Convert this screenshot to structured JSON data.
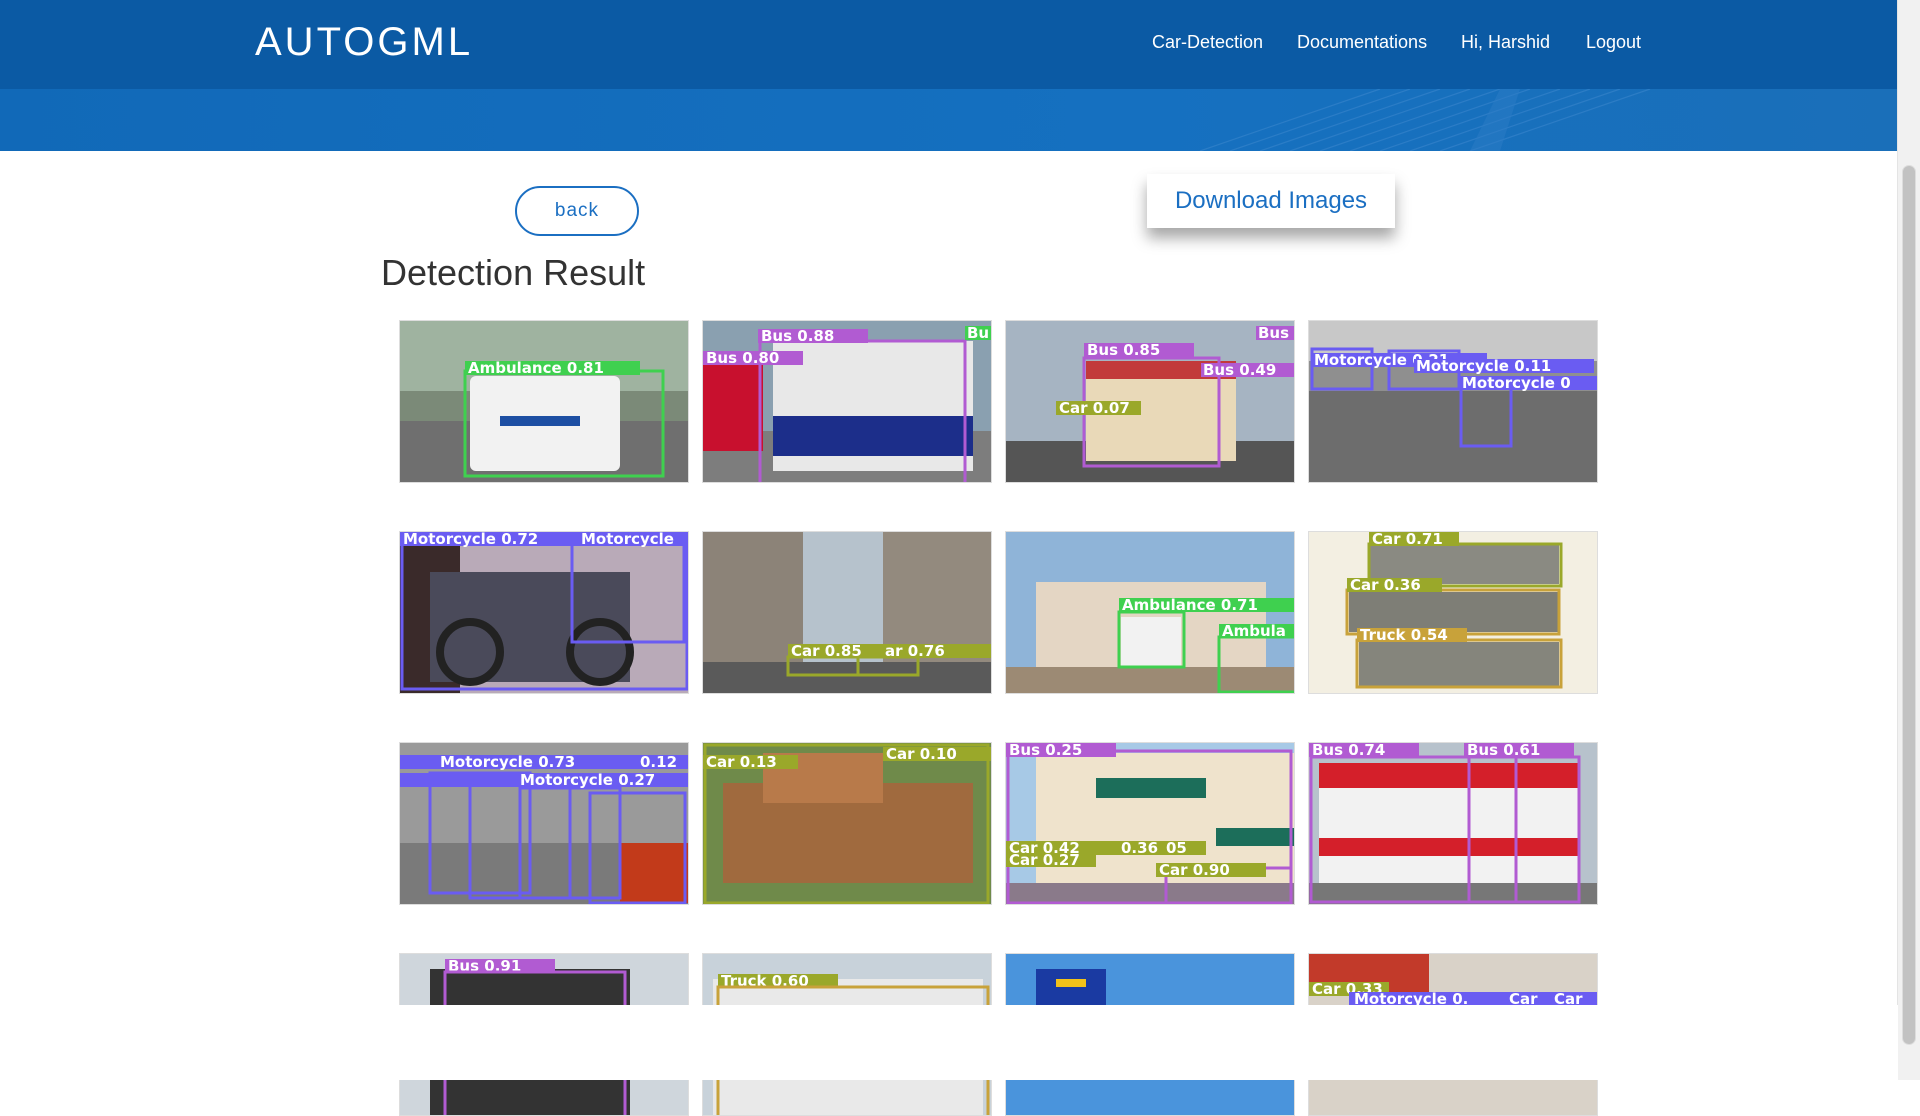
{
  "header": {
    "brand": "AUTOGML",
    "nav": [
      "Car-Detection",
      "Documentations",
      "Hi, Harshid",
      "Logout"
    ]
  },
  "actions": {
    "back_label": "back",
    "download_label": "Download Images"
  },
  "page_title": "Detection Result",
  "colors": {
    "header": "#0b5aa4",
    "accent": "#1b6fc2"
  },
  "results": [
    {
      "labels": [
        "Ambulance 0.81"
      ]
    },
    {
      "labels": [
        "Bus 0.88",
        "Bus 0.80",
        "Bu"
      ]
    },
    {
      "labels": [
        "Bus 0.85",
        "Bus 0.49",
        "Bus",
        "Car 0.07"
      ]
    },
    {
      "labels": [
        "Motorcycle 0.21",
        "Motorcycle 0.11",
        "Motorcycle 0"
      ]
    },
    {
      "labels": [
        "Motorcycle 0.72",
        "Motorcycle"
      ]
    },
    {
      "labels": [
        "Car 0.85",
        "ar 0.76"
      ]
    },
    {
      "labels": [
        "Ambulance 0.71",
        "Ambula"
      ]
    },
    {
      "labels": [
        "Car 0.71",
        "Car 0.36",
        "Truck 0.54"
      ]
    },
    {
      "labels": [
        "Motorcycle 0.73",
        "Motorcycle 0.27",
        "0.12"
      ]
    },
    {
      "labels": [
        "Car 0.13",
        "Car 0.10"
      ]
    },
    {
      "labels": [
        "Bus 0.25",
        "Car 0.42",
        "Car 0.27",
        "0.36",
        "05",
        "Car 0.90"
      ]
    },
    {
      "labels": [
        "Bus 0.74",
        "Bus 0.61"
      ]
    },
    {
      "labels": [
        "Bus 0.91"
      ]
    },
    {
      "labels": [
        "Truck 0.60"
      ]
    },
    {
      "labels": []
    },
    {
      "labels": [
        "Car 0.33",
        "Motorcycle 0.",
        "Car",
        "Car"
      ]
    }
  ]
}
